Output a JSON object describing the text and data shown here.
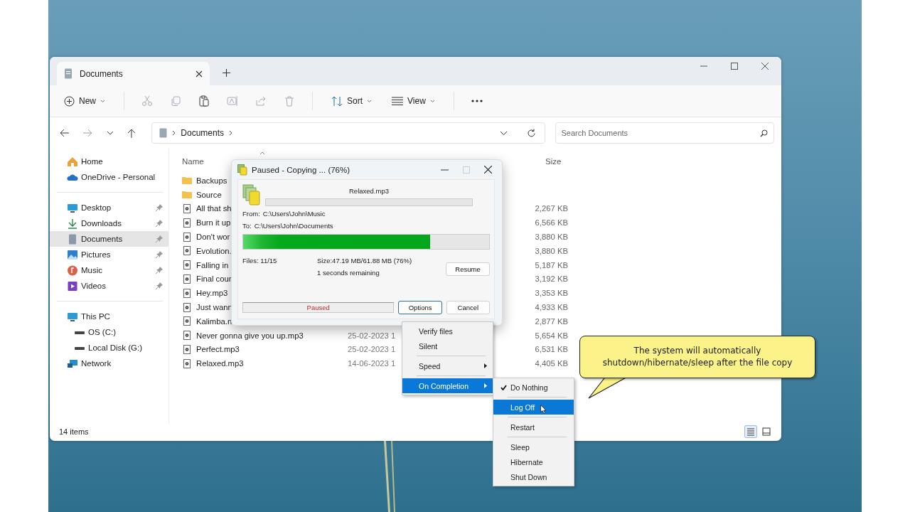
{
  "explorer": {
    "tab_title": "Documents",
    "toolbar": {
      "new": "New",
      "sort": "Sort",
      "view": "View"
    },
    "address": {
      "crumb": "Documents",
      "search_placeholder": "Search Documents"
    },
    "sidebar": [
      {
        "label": "Home",
        "pinned": false,
        "selected": false
      },
      {
        "label": "OneDrive - Personal",
        "pinned": false,
        "selected": false
      },
      {
        "label": "Desktop",
        "pinned": true,
        "selected": false
      },
      {
        "label": "Downloads",
        "pinned": true,
        "selected": false
      },
      {
        "label": "Documents",
        "pinned": true,
        "selected": true
      },
      {
        "label": "Pictures",
        "pinned": true,
        "selected": false
      },
      {
        "label": "Music",
        "pinned": true,
        "selected": false
      },
      {
        "label": "Videos",
        "pinned": true,
        "selected": false
      },
      {
        "label": "This PC",
        "pinned": false,
        "selected": false,
        "children": [
          {
            "label": "OS (C:)"
          },
          {
            "label": "Local Disk (G:)"
          }
        ]
      },
      {
        "label": "Network",
        "pinned": false,
        "selected": false
      }
    ],
    "columns": {
      "name": "Name",
      "size": "Size"
    },
    "files": [
      {
        "name": "Backups",
        "kind": "folder"
      },
      {
        "name": "Source",
        "kind": "folder"
      },
      {
        "name": "All that sh",
        "kind": "audio",
        "size": "2,267 KB"
      },
      {
        "name": "Burn it up",
        "kind": "audio",
        "size": "6,566 KB"
      },
      {
        "name": "Don't wor",
        "kind": "audio",
        "size": "3,880 KB"
      },
      {
        "name": "Evolution.",
        "kind": "audio",
        "size": "3,880 KB"
      },
      {
        "name": "Falling in",
        "kind": "audio",
        "size": "5,187 KB"
      },
      {
        "name": "Final cour",
        "kind": "audio",
        "size": "3,192 KB"
      },
      {
        "name": "Hey.mp3",
        "kind": "audio",
        "size": "3,353 KB"
      },
      {
        "name": "Just wann",
        "kind": "audio",
        "size": "4,933 KB"
      },
      {
        "name": "Kalimba.n",
        "kind": "audio",
        "size": "2,877 KB"
      },
      {
        "name": "Never gonna give you up.mp3",
        "kind": "audio",
        "date": "25-02-2023 1",
        "size": "5,654 KB"
      },
      {
        "name": "Perfect.mp3",
        "kind": "audio",
        "date": "25-02-2023 1",
        "size": "6,531 KB"
      },
      {
        "name": "Relaxed.mp3",
        "kind": "audio",
        "date": "14-06-2023 1",
        "size": "4,405 KB"
      }
    ],
    "status": "14 items"
  },
  "copy_dialog": {
    "title": "Paused - Copying ... (76%)",
    "file": "Relaxed.mp3",
    "file_progress": {
      "level": 0
    },
    "from_label": "From:",
    "from": "C:\\Users\\John\\Music",
    "to_label": "To:",
    "to": "C:\\Users\\John\\Documents",
    "overall": {
      "level": 0.76
    },
    "files": "Files: 11/15",
    "size": "Size:47.19 MB/61.88 MB (76%)",
    "remaining": "1 seconds remaining",
    "resume": "Resume",
    "state": "Paused",
    "options": "Options",
    "cancel": "Cancel"
  },
  "options_menu": [
    {
      "label": "Verify files",
      "kind": "item",
      "selected": false
    },
    {
      "label": "Silent",
      "kind": "item",
      "selected": false
    },
    {
      "label": "Speed",
      "kind": "submenu",
      "selected": false
    },
    {
      "label": "On Completion",
      "kind": "submenu",
      "selected": true
    }
  ],
  "completion_menu": [
    {
      "label": "Do Nothing",
      "checked": true,
      "selected": false
    },
    {
      "label": "Log Off",
      "checked": false,
      "selected": true
    },
    {
      "label": "Restart",
      "checked": false,
      "selected": false
    },
    {
      "label": "Sleep",
      "checked": false,
      "selected": false
    },
    {
      "label": "Hibernate",
      "checked": false,
      "selected": false
    },
    {
      "label": "Shut Down",
      "checked": false,
      "selected": false
    }
  ],
  "callout": {
    "line1": "The system will automatically",
    "line2": "shutdown/hibernate/sleep after the file copy"
  }
}
